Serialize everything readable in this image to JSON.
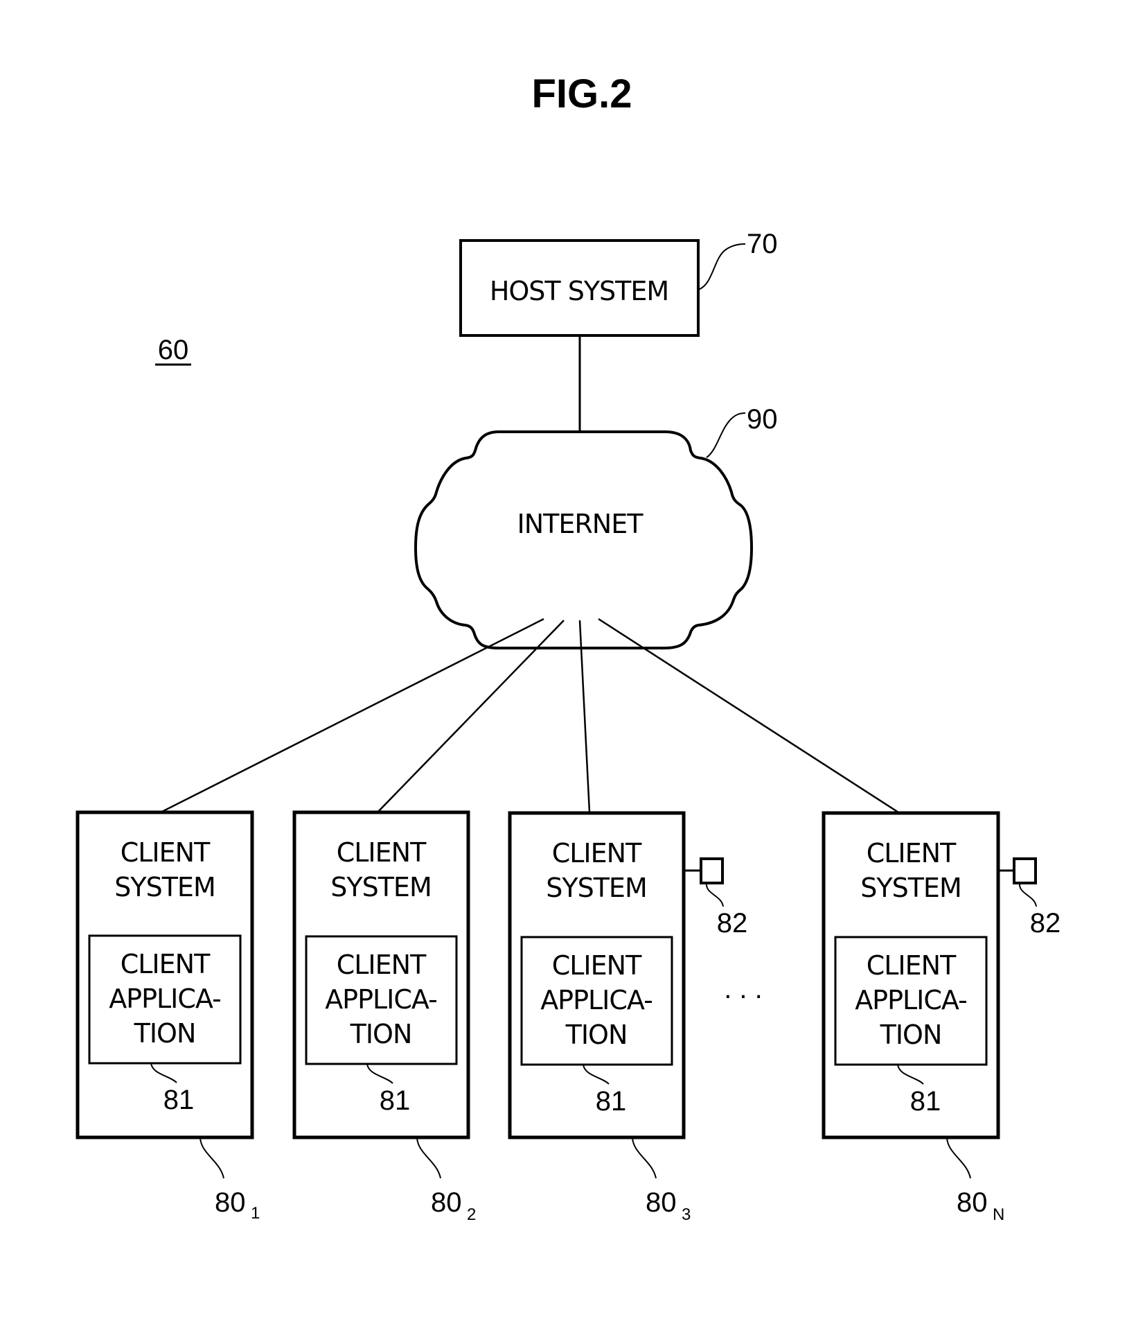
{
  "figure": {
    "title": "FIG.2",
    "system_ref": "60"
  },
  "host": {
    "label": "HOST SYSTEM",
    "ref": "70"
  },
  "network": {
    "label": "INTERNET",
    "ref": "90"
  },
  "clients": [
    {
      "system_label_1": "CLIENT",
      "system_label_2": "SYSTEM",
      "app_label_1": "CLIENT",
      "app_label_2": "APPLICA-",
      "app_label_3": "TION",
      "app_ref": "81",
      "ref": "80",
      "ref_sub": "1",
      "has_peripheral": false
    },
    {
      "system_label_1": "CLIENT",
      "system_label_2": "SYSTEM",
      "app_label_1": "CLIENT",
      "app_label_2": "APPLICA-",
      "app_label_3": "TION",
      "app_ref": "81",
      "ref": "80",
      "ref_sub": "2",
      "has_peripheral": false
    },
    {
      "system_label_1": "CLIENT",
      "system_label_2": "SYSTEM",
      "app_label_1": "CLIENT",
      "app_label_2": "APPLICA-",
      "app_label_3": "TION",
      "app_ref": "81",
      "ref": "80",
      "ref_sub": "3",
      "has_peripheral": true,
      "peripheral_ref": "82"
    },
    {
      "system_label_1": "CLIENT",
      "system_label_2": "SYSTEM",
      "app_label_1": "CLIENT",
      "app_label_2": "APPLICA-",
      "app_label_3": "TION",
      "app_ref": "81",
      "ref": "80",
      "ref_sub": "N",
      "has_peripheral": true,
      "peripheral_ref": "82"
    }
  ],
  "ellipsis": ". . ."
}
